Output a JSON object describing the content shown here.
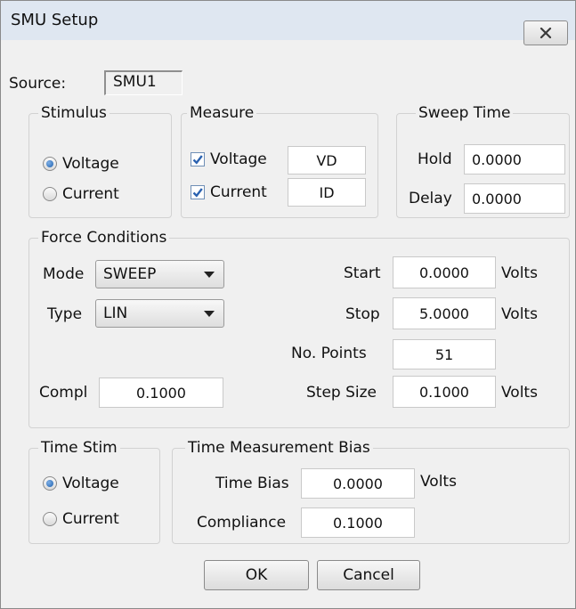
{
  "window": {
    "title": "SMU Setup"
  },
  "source": {
    "label": "Source:",
    "value": "SMU1"
  },
  "stimulus": {
    "legend": "Stimulus",
    "options": [
      {
        "label": "Voltage",
        "selected": true
      },
      {
        "label": "Current",
        "selected": false
      }
    ]
  },
  "measure": {
    "legend": "Measure",
    "rows": [
      {
        "label": "Voltage",
        "checked": true,
        "value": "VD"
      },
      {
        "label": "Current",
        "checked": true,
        "value": "ID"
      }
    ]
  },
  "sweep_time": {
    "legend": "Sweep Time",
    "hold_label": "Hold",
    "hold_value": "0.0000",
    "delay_label": "Delay",
    "delay_value": "0.0000"
  },
  "force": {
    "legend": "Force Conditions",
    "mode_label": "Mode",
    "mode_value": "SWEEP",
    "type_label": "Type",
    "type_value": "LIN",
    "compl_label": "Compl",
    "compl_value": "0.1000",
    "start_label": "Start",
    "start_value": "0.0000",
    "start_unit": "Volts",
    "stop_label": "Stop",
    "stop_value": "5.0000",
    "stop_unit": "Volts",
    "points_label": "No. Points",
    "points_value": "51",
    "step_label": "Step Size",
    "step_value": "0.1000",
    "step_unit": "Volts"
  },
  "time_stim": {
    "legend": "Time Stim",
    "options": [
      {
        "label": "Voltage",
        "selected": true
      },
      {
        "label": "Current",
        "selected": false
      }
    ]
  },
  "time_bias": {
    "legend": "Time Measurement Bias",
    "bias_label": "Time Bias",
    "bias_value": "0.0000",
    "bias_unit": "Volts",
    "compliance_label": "Compliance",
    "compliance_value": "0.1000"
  },
  "buttons": {
    "ok": "OK",
    "cancel": "Cancel"
  },
  "colors": {
    "accent": "#1d5fae",
    "check": "#2b62b0"
  },
  "icons": {
    "close": "close-x-icon",
    "dropdown": "chevron-down-icon"
  }
}
